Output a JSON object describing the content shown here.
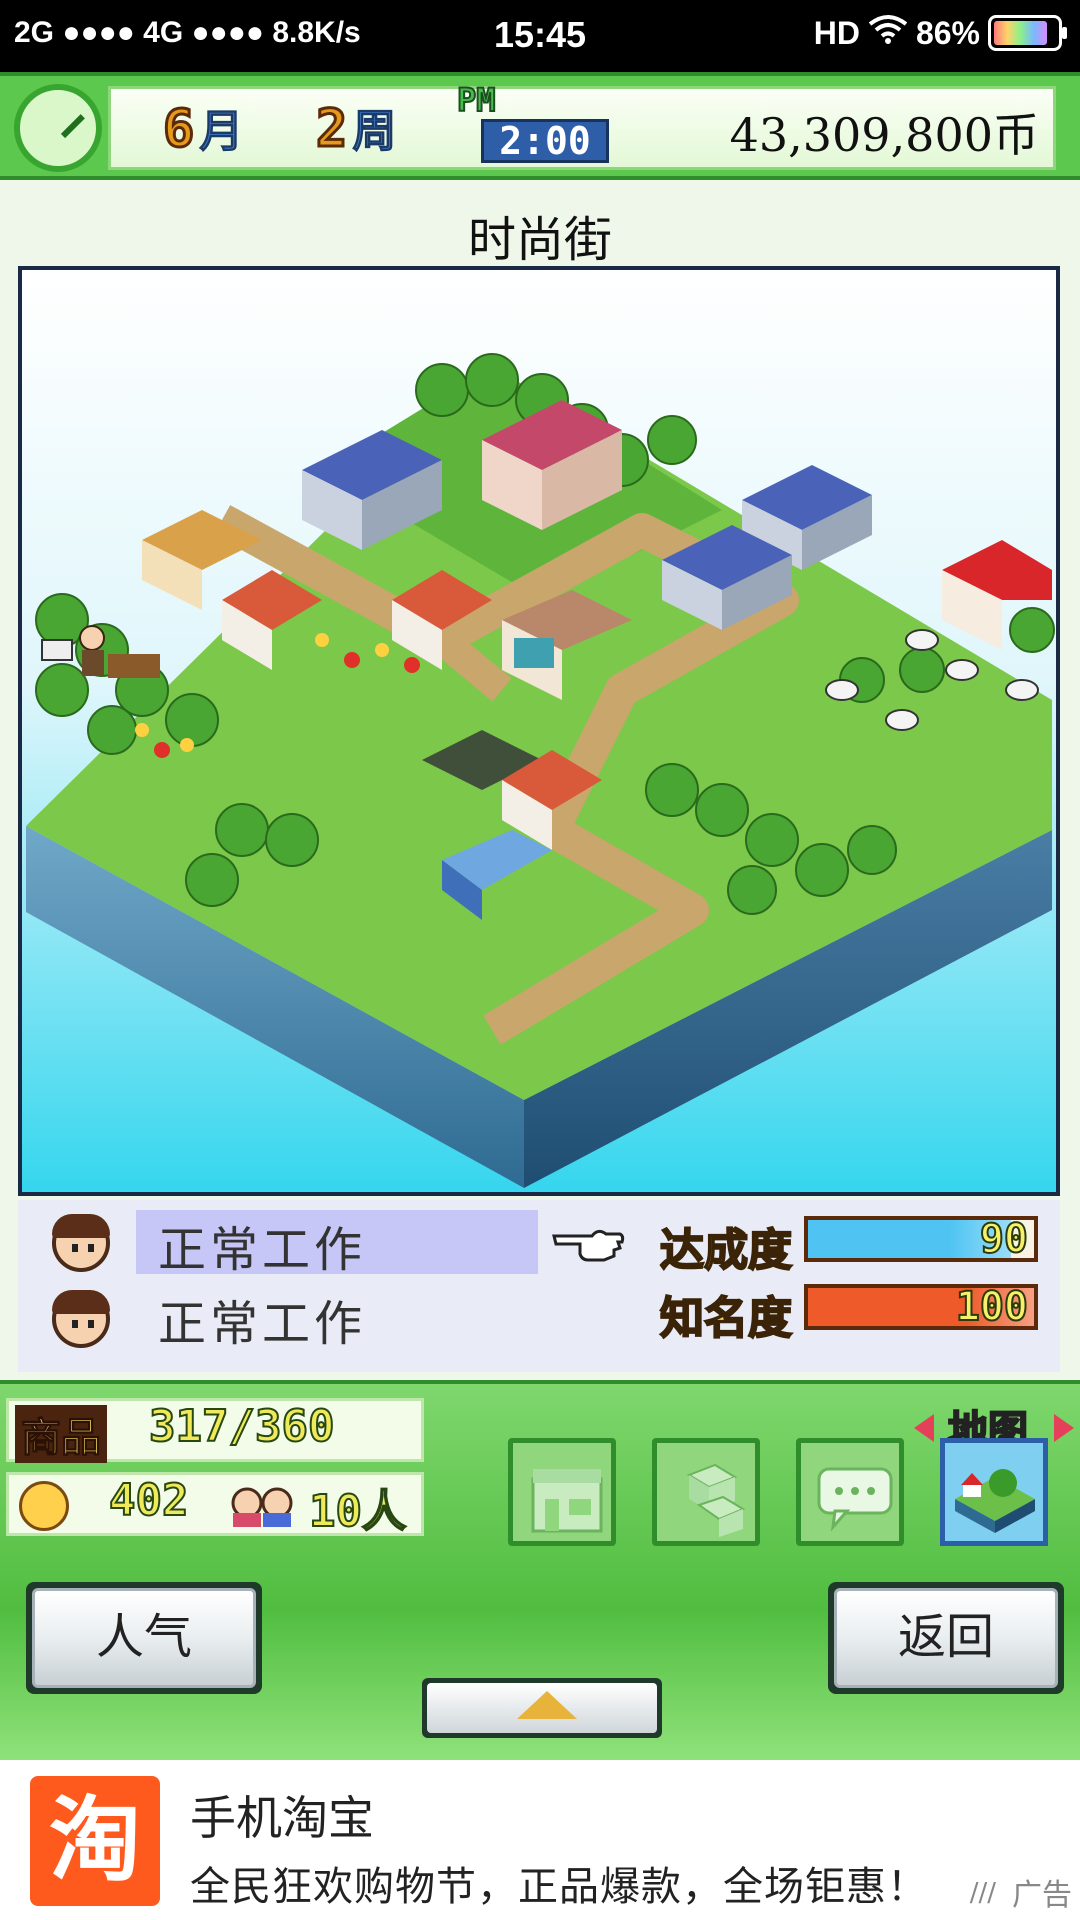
{
  "status_bar": {
    "left": "2G ●●●● 4G ●●●● 8.8K/s",
    "time": "15:45",
    "right_hd": "HD",
    "battery": "86%"
  },
  "hud": {
    "month_num": "6",
    "month_unit": "月",
    "week_num": "2",
    "week_unit": "周",
    "ampm": "PM",
    "time": "2:00",
    "money": "43,309,800币"
  },
  "town": {
    "title": "时尚街"
  },
  "staff": [
    {
      "status": "正常工作",
      "selected": true
    },
    {
      "status": "正常工作",
      "selected": false
    }
  ],
  "meters": [
    {
      "label": "达成度",
      "value": "90",
      "fill": 0.9,
      "color": "#4fc4f3"
    },
    {
      "label": "知名度",
      "value": "100",
      "fill": 1.0,
      "color": "#ef5a2a"
    }
  ],
  "stats": {
    "goods_label": "商品",
    "goods_value": "317/360",
    "visitors_value": "402",
    "people_value": "10人"
  },
  "tools": [
    {
      "name": "build",
      "icon": "shop-icon"
    },
    {
      "name": "items",
      "icon": "boxes-icon"
    },
    {
      "name": "chat",
      "icon": "chat-bubble-icon"
    }
  ],
  "map_button": {
    "label": "地图"
  },
  "buttons": {
    "popularity": "人气",
    "back": "返回"
  },
  "ad": {
    "logo_char": "淘",
    "title": "手机淘宝",
    "desc": "全民狂欢购物节，正品爆款，全场钜惠！",
    "tag": "广告"
  }
}
